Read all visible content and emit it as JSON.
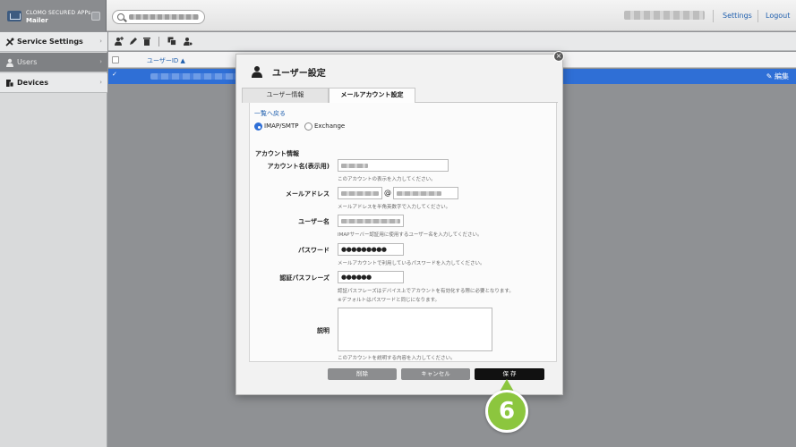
{
  "header": {
    "brand_line1": "CLOMO SECURED APPs",
    "brand_line2": "Mailer",
    "settings_label": "Settings",
    "logout_label": "Logout"
  },
  "sidebar": {
    "items": [
      {
        "label": "Service Settings",
        "icon": "wrench-screwdriver-icon"
      },
      {
        "label": "Users",
        "icon": "user-icon",
        "active": true
      },
      {
        "label": "Devices",
        "icon": "devices-icon"
      }
    ]
  },
  "table": {
    "col_userid": "ユーザーID ▲",
    "row_edit": "✎ 編集"
  },
  "modal": {
    "title": "ユーザー設定",
    "tabs": [
      "ユーザー情報",
      "メールアカウント設定"
    ],
    "back_link": "一覧へ戻る",
    "radio_imap": "IMAP/SMTP",
    "radio_exchange": "Exchange",
    "section_title": "アカウント情報",
    "fields": {
      "account_name_label": "アカウント名(表示用)",
      "account_name_hint": "このアカウントの表示を入力してください。",
      "email_label": "メールアドレス",
      "email_at": "@",
      "email_hint": "メールアドレスを半角英数字で入力してください。",
      "username_label": "ユーザー名",
      "username_hint": "IMAPサーバー認証用に使用するユーザー名を入力してください。",
      "password_label": "パスワード",
      "password_value": "●●●●●●●●●",
      "password_hint": "メールアカウントで利用しているパスワードを入力してください。",
      "passphrase_label": "認証パスフレーズ",
      "passphrase_value": "●●●●●●",
      "passphrase_hint1": "認証パスフレーズはデバイス上でアカウントを有効化する際に必要となります。",
      "passphrase_hint2": "※デフォルトはパスワードと同じになります。",
      "description_label": "説明",
      "description_hint": "このアカウントを説明する内容を入力してください。"
    },
    "buttons": {
      "delete": "削除",
      "cancel": "キャンセル",
      "save": "保 存"
    }
  },
  "annotation": {
    "step_number": "6"
  },
  "colors": {
    "accent_blue": "#2f6fd6",
    "step_green": "#8cc63e",
    "link_blue": "#1f5fae"
  }
}
